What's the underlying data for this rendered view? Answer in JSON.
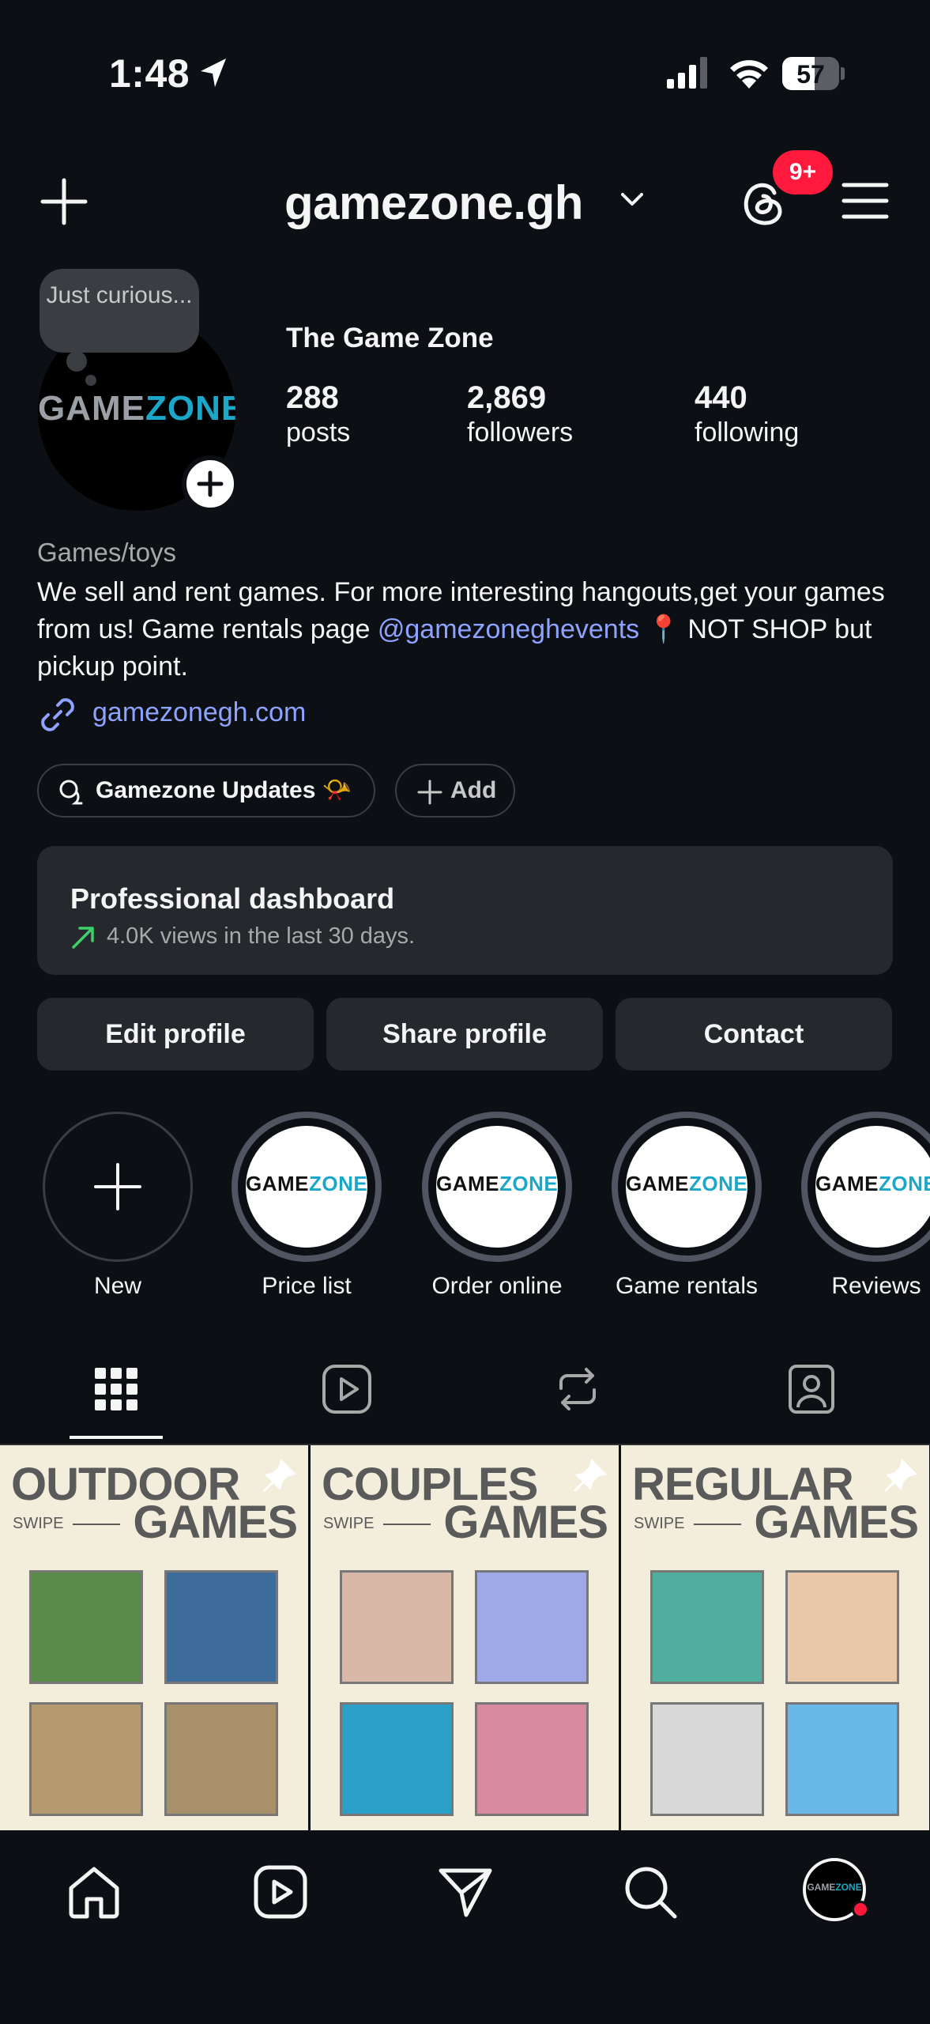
{
  "status_bar": {
    "time": "1:48",
    "battery": "57",
    "battery_level": 0.57
  },
  "header": {
    "username": "gamezone.gh",
    "notification_badge": "9+"
  },
  "profile": {
    "note": "Just curious...",
    "avatar_logo": "GAMEZONE",
    "display_name": "The Game Zone",
    "stats": [
      {
        "value": "288",
        "label": "posts"
      },
      {
        "value": "2,869",
        "label": "followers"
      },
      {
        "value": "440",
        "label": "following"
      }
    ],
    "category": "Games/toys",
    "bio_part1": "We sell and rent games. For more interesting hangouts,get your games from us! Game rentals page ",
    "bio_mention": "@gamezoneghevents",
    "bio_part2": " 📍 NOT SHOP but pickup point.",
    "link": "gamezonegh.com"
  },
  "chips": {
    "updates": "Gamezone Updates 📯",
    "add": "Add"
  },
  "dashboard": {
    "title": "Professional dashboard",
    "subtitle": "4.0K views in the last 30 days."
  },
  "buttons": {
    "edit": "Edit profile",
    "share": "Share profile",
    "contact": "Contact"
  },
  "highlights": [
    {
      "label": "New"
    },
    {
      "label": "Price list",
      "logo": "GAMEZONE"
    },
    {
      "label": "Order online",
      "logo": "GAMEZONE"
    },
    {
      "label": "Game rentals",
      "logo": "GAMEZONE"
    },
    {
      "label": "Reviews",
      "logo": "GAMEZONE"
    }
  ],
  "grid": [
    {
      "title1": "OUTDOOR",
      "title2": "GAMES",
      "swipe": "SWIPE"
    },
    {
      "title1": "COUPLES",
      "title2": "GAMES",
      "swipe": "SWIPE"
    },
    {
      "title1": "REGULAR",
      "title2": "GAMES",
      "swipe": "SWIPE"
    }
  ],
  "colors": {
    "background": "#0c1014",
    "link": "#8ea2ff",
    "badge": "#ff1a3d",
    "card": "#25292e"
  }
}
